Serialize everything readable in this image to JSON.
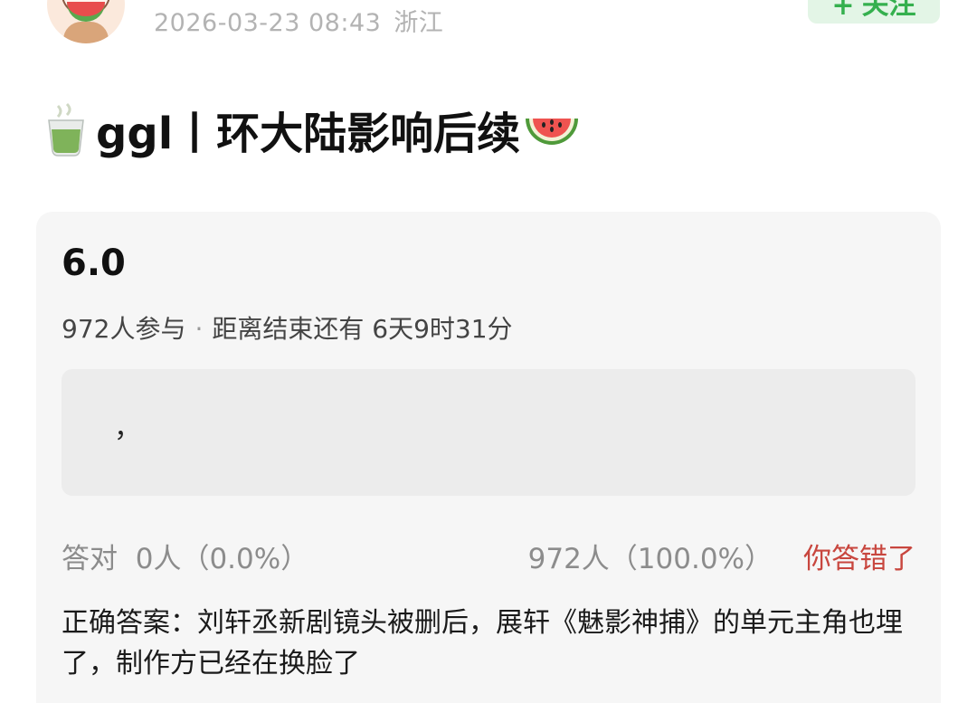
{
  "header": {
    "date": "2026-03-23 08:43",
    "location": "浙江",
    "follow_label": "关注",
    "follow_icon": "plus-icon"
  },
  "post": {
    "title": "ggl丨环大陆影响后续",
    "leading_icon": "tea-cup-icon",
    "trailing_icon": "watermelon-icon"
  },
  "quiz": {
    "score": "6.0",
    "participants": "972人参与",
    "separator": "·",
    "time_left": "距离结束还有 6天9时31分",
    "answer_text": "，",
    "correct_label": "答对",
    "correct_stat": "0人（0.0%）",
    "wrong_stat": "972人（100.0%）",
    "wrong_tag": "你答错了",
    "correct_answer": "正确答案：刘轩丞新剧镜头被删后，展轩《魅影神捕》的单元主角也埋了，制作方已经在换脸了"
  },
  "colors": {
    "accent_green": "#35b04e",
    "follow_bg": "#e3f5e6",
    "wrong_red": "#c8463e",
    "card_bg": "#f6f6f6"
  }
}
